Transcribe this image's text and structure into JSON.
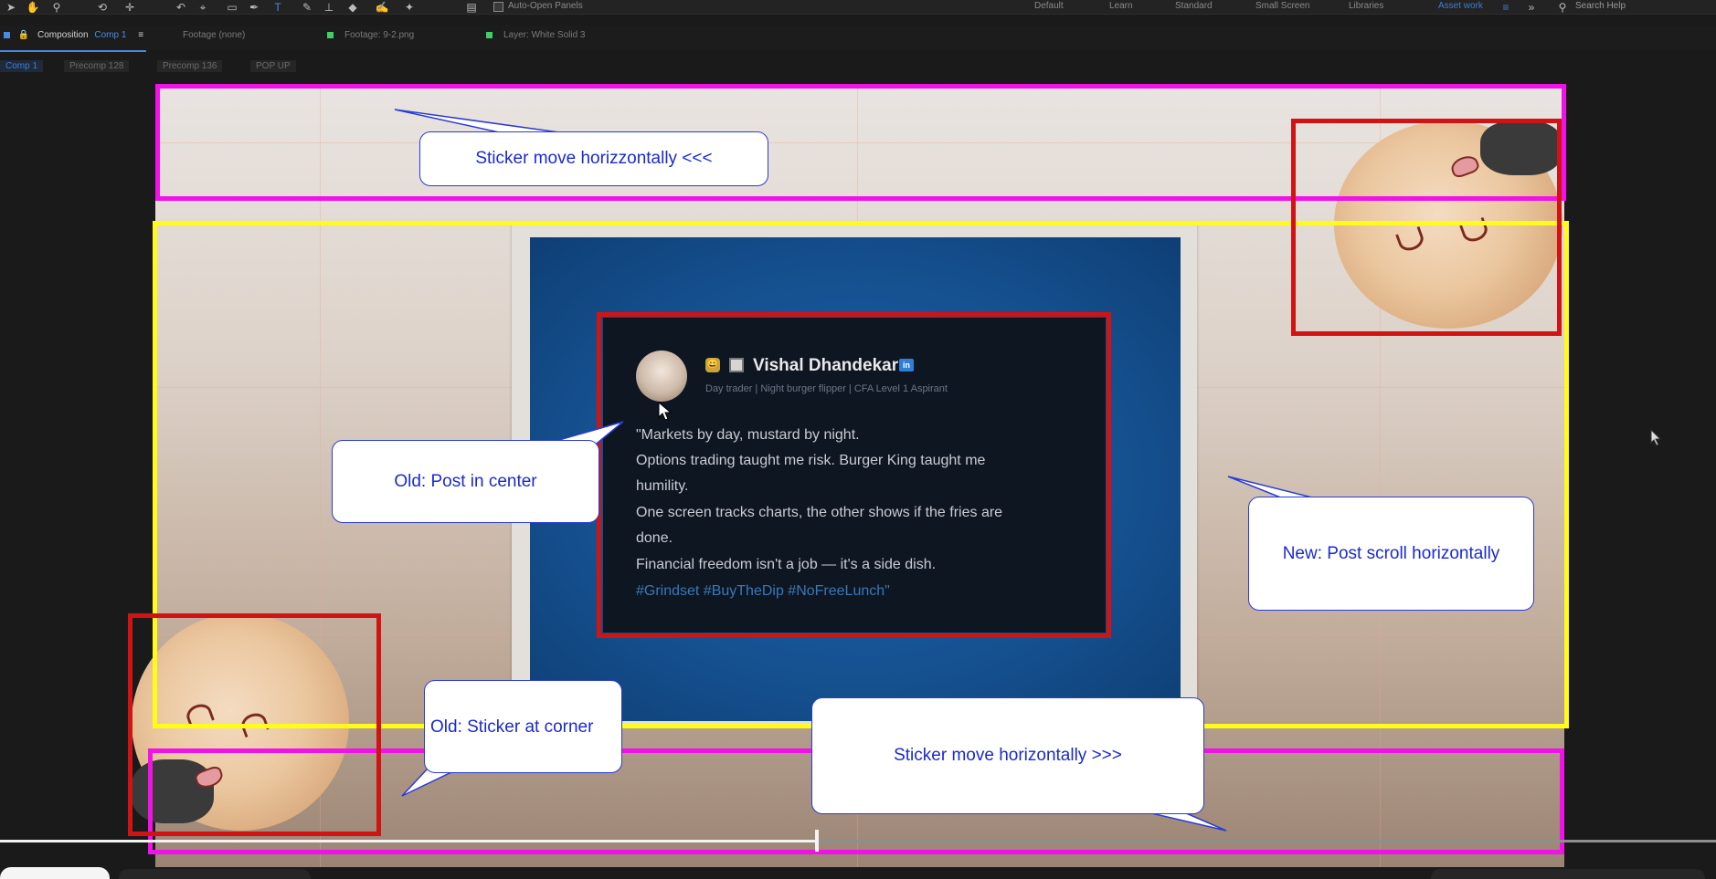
{
  "toolbar": {
    "auto_open_panels": "Auto-Open Panels",
    "workspaces": [
      "Default",
      "Learn",
      "Standard",
      "Small Screen",
      "Libraries",
      "Asset work"
    ],
    "search_placeholder": "Search Help"
  },
  "tabs": {
    "composition": "Composition",
    "composition_name": "Comp 1",
    "footage": "Footage (none)",
    "layer_file": "Footage: 9-2.png",
    "layer": "Layer: White Solid 3"
  },
  "breadcrumbs": [
    "Comp 1",
    "Precomp 128",
    "Precomp 136",
    "POP UP"
  ],
  "post": {
    "name": "Vishal Dhandekar",
    "badge": "in",
    "emoji": "😀",
    "meta": "Day trader | Night burger flipper | CFA Level 1 Aspirant",
    "lines": [
      "\"Markets by day, mustard by night.",
      "Options trading taught me risk. Burger King taught me",
      "humility.",
      "One screen tracks charts, the other shows if the fries are",
      "done.",
      "Financial freedom isn't a job — it's a side dish."
    ],
    "tags": "#Grindset #BuyTheDip #NoFreeLunch\""
  },
  "callouts": {
    "top": "Sticker move horizzontally <<<",
    "old_post": "Old: Post in center",
    "new_post": "New: Post scroll horizontally",
    "old_sticker": "Old: Sticker at corner",
    "bottom": "Sticker move horizontally >>>"
  },
  "colors": {
    "magenta": "#f012e6",
    "yellow": "#fffb1a",
    "red": "#d01414",
    "callout_text": "#1a2ad0"
  },
  "player": {
    "progress": 0.476
  }
}
